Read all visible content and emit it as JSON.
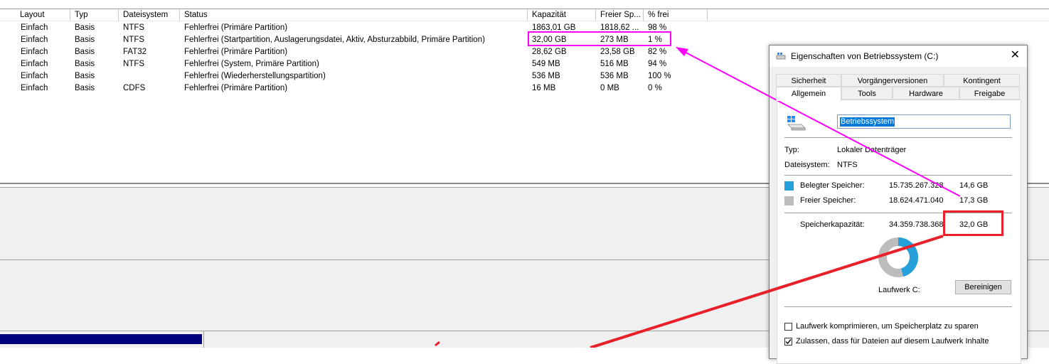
{
  "columns": [
    "Layout",
    "Typ",
    "Dateisystem",
    "Status",
    "Kapazität",
    "Freier Sp...",
    "% frei"
  ],
  "rows": [
    [
      "Einfach",
      "Basis",
      "NTFS",
      "Fehlerfrei (Primäre Partition)",
      "1863,01 GB",
      "1818,62 ...",
      "98 %"
    ],
    [
      "Einfach",
      "Basis",
      "NTFS",
      "Fehlerfrei (Startpartition, Auslagerungsdatei, Aktiv, Absturzabbild, Primäre Partition)",
      "32,00 GB",
      "273 MB",
      "1 %"
    ],
    [
      "Einfach",
      "Basis",
      "FAT32",
      "Fehlerfrei (Primäre Partition)",
      "28,62 GB",
      "23,58 GB",
      "82 %"
    ],
    [
      "Einfach",
      "Basis",
      "NTFS",
      "Fehlerfrei (System, Primäre Partition)",
      "549 MB",
      "516 MB",
      "94 %"
    ],
    [
      "Einfach",
      "Basis",
      "",
      "Fehlerfrei (Wiederherstellungspartition)",
      "536 MB",
      "536 MB",
      "100 %"
    ],
    [
      "Einfach",
      "Basis",
      "CDFS",
      "Fehlerfrei (Primäre Partition)",
      "16 MB",
      "0 MB",
      "0 %"
    ]
  ],
  "dialog": {
    "title": "Eigenschaften von Betriebssystem (C:)",
    "close": "✕",
    "tabs_row1": [
      "Sicherheit",
      "Vorgängerversionen",
      "Kontingent"
    ],
    "tabs_row2": [
      "Allgemein",
      "Tools",
      "Hardware",
      "Freigabe"
    ],
    "name_value": "Betriebssystem",
    "typ_label": "Typ:",
    "typ_value": "Lokaler Datenträger",
    "fs_label": "Dateisystem:",
    "fs_value": "NTFS",
    "used_label": "Belegter Speicher:",
    "used_bytes": "15.735.267.328",
    "used_gb": "14,6 GB",
    "free_label": "Freier Speicher:",
    "free_bytes": "18.624.471.040",
    "free_gb": "17,3 GB",
    "cap_label": "Speicherkapazität:",
    "cap_bytes": "34.359.738.368",
    "cap_gb": "32,0 GB",
    "drive_label": "Laufwerk C:",
    "cleanup_button": "Bereinigen",
    "compress_label": "Laufwerk komprimieren, um Speicherplatz zu sparen",
    "index_label": "Zulassen, dass für Dateien auf diesem Laufwerk Inhalte",
    "used_fraction": 0.458,
    "colors": {
      "used": "#26a0da",
      "free": "#bcbcbc",
      "highlight_magenta": "#ff00ff",
      "highlight_red": "#e8202a"
    }
  }
}
